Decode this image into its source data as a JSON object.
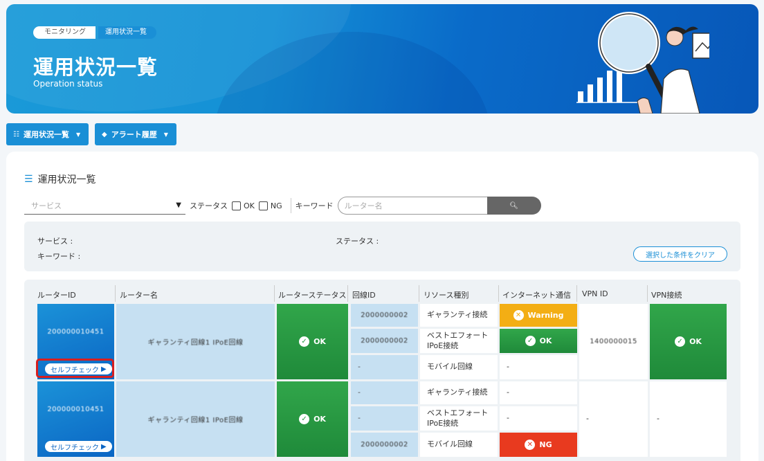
{
  "header": {
    "breadcrumbs": [
      "モニタリング",
      "運用状況一覧"
    ],
    "title": "運用状況一覧",
    "subtitle": "Operation status"
  },
  "nav": {
    "status_btn": "運用状況一覧",
    "alert_btn": "アラート履歴"
  },
  "section": {
    "title": "運用状況一覧"
  },
  "filter": {
    "service_placeholder": "サービス",
    "status_label": "ステータス",
    "ok_label": "OK",
    "ng_label": "NG",
    "keyword_label": "キーワード",
    "keyword_placeholder": "ルーター名"
  },
  "conditions": {
    "service": "サービス :",
    "status": "ステータス :",
    "keyword": "キーワード :",
    "clear": "選択した条件をクリア"
  },
  "table": {
    "headers": [
      "ルーターID",
      "ルーター名",
      "ルーターステータス",
      "回線ID",
      "リソース種別",
      "インターネット通信",
      "VPN ID",
      "VPN接続"
    ],
    "self_check": "セルフチェック",
    "dash": "-",
    "rows": [
      {
        "router_id": "200000010451",
        "router_name": "ギャランティ回線1 IPoE回線",
        "router_status": "OK",
        "lines": [
          {
            "line_id": "2000000002",
            "resource": "ギャランティ接続",
            "internet": "Warning"
          },
          {
            "line_id": "2000000002",
            "resource": "ベストエフォート IPoE接続",
            "internet": "OK"
          },
          {
            "line_id": "-",
            "resource": "モバイル回線",
            "internet": "-"
          }
        ],
        "vpn_id": "1400000015",
        "vpn_status": "OK"
      },
      {
        "router_id": "200000010451",
        "router_name": "ギャランティ回線1 IPoE回線",
        "router_status": "OK",
        "lines": [
          {
            "line_id": "-",
            "resource": "ギャランティ接続",
            "internet": "-"
          },
          {
            "line_id": "-",
            "resource": "ベストエフォート IPoE接続",
            "internet": "-"
          },
          {
            "line_id": "2000000002",
            "resource": "モバイル回線",
            "internet": "NG"
          }
        ],
        "vpn_id": "-",
        "vpn_status": "-"
      }
    ]
  },
  "colors": {
    "primary": "#1a8fd6",
    "ok": "#249a42",
    "warning": "#f3ae14",
    "ng": "#e83a1f",
    "highlight": "#d81e1e"
  }
}
